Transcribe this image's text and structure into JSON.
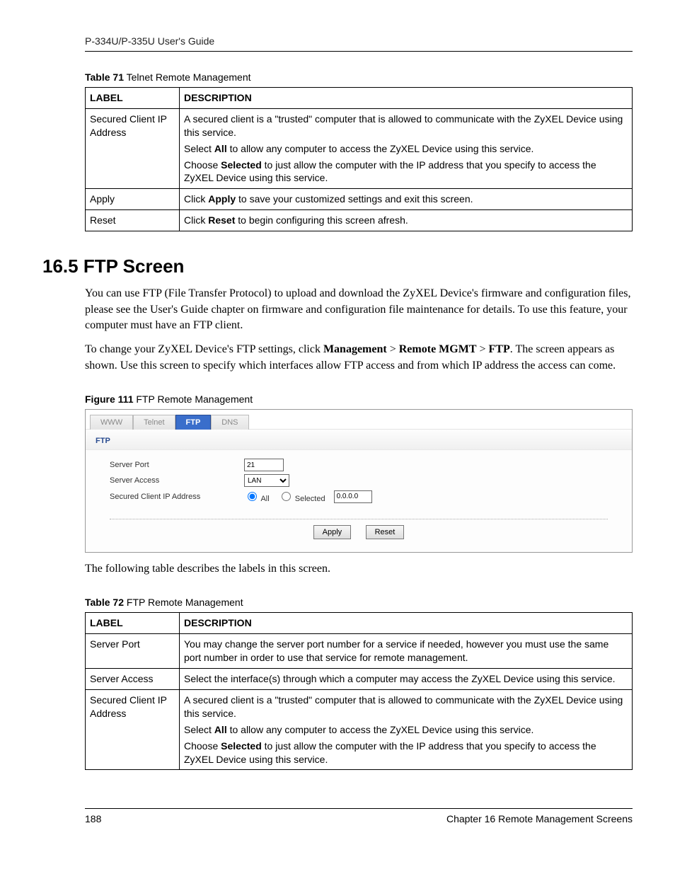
{
  "header": {
    "guide_title": "P-334U/P-335U User's Guide"
  },
  "table71": {
    "caption_bold": "Table 71",
    "caption_rest": "   Telnet Remote Management",
    "headers": {
      "label": "LABEL",
      "desc": "DESCRIPTION"
    },
    "rows": [
      {
        "label": "Secured Client IP Address",
        "desc_parts": [
          {
            "pre": "A secured client is a \"trusted\" computer that is allowed to communicate with the ZyXEL Device using this service."
          },
          {
            "pre": "Select ",
            "bold": "All",
            "post": " to allow any computer to access the ZyXEL Device using this service."
          },
          {
            "pre": "Choose ",
            "bold": "Selected",
            "post": " to just allow the computer with the IP address that you specify to access the ZyXEL Device using this service."
          }
        ]
      },
      {
        "label": "Apply",
        "desc_parts": [
          {
            "pre": "Click ",
            "bold": "Apply",
            "post": " to save your customized settings and exit this screen."
          }
        ]
      },
      {
        "label": "Reset",
        "desc_parts": [
          {
            "pre": "Click ",
            "bold": "Reset",
            "post": " to begin configuring this screen afresh."
          }
        ]
      }
    ]
  },
  "section": {
    "heading": "16.5  FTP Screen",
    "para1": "You can use FTP (File Transfer Protocol) to upload and download the ZyXEL Device's firmware and configuration files, please see the User's Guide chapter on firmware and configuration file maintenance for details. To use this feature, your computer must have an FTP client.",
    "para2_pre": "To change your ZyXEL Device's FTP settings, click ",
    "para2_b1": "Management",
    "para2_gt1": " > ",
    "para2_b2": "Remote MGMT",
    "para2_gt2": " > ",
    "para2_b3": "FTP",
    "para2_post": ". The screen appears as shown.  Use this screen to specify which interfaces allow FTP access and from which IP address the access can come."
  },
  "figure": {
    "caption_bold": "Figure 111",
    "caption_rest": "   FTP Remote Management",
    "tabs": [
      "WWW",
      "Telnet",
      "FTP",
      "DNS"
    ],
    "active_tab": "FTP",
    "panel_title": "FTP",
    "fields": {
      "server_port_label": "Server Port",
      "server_port_value": "21",
      "server_access_label": "Server Access",
      "server_access_value": "LAN",
      "secured_label": "Secured Client IP Address",
      "radio_all": "All",
      "radio_selected": "Selected",
      "ip_value": "0.0.0.0"
    },
    "buttons": {
      "apply": "Apply",
      "reset": "Reset"
    }
  },
  "after_figure": "The following table describes the labels in this screen.",
  "table72": {
    "caption_bold": "Table 72",
    "caption_rest": "   FTP Remote Management",
    "headers": {
      "label": "LABEL",
      "desc": "DESCRIPTION"
    },
    "rows": [
      {
        "label": "Server Port",
        "desc_parts": [
          {
            "pre": "You may change the server port number for a service if needed, however you must use the same port number in order to use that service for remote management."
          }
        ]
      },
      {
        "label": "Server Access",
        "desc_parts": [
          {
            "pre": "Select the interface(s) through which a computer may access the ZyXEL Device using this service."
          }
        ]
      },
      {
        "label": "Secured Client IP Address",
        "desc_parts": [
          {
            "pre": "A secured client is a \"trusted\" computer that is allowed to communicate with the ZyXEL Device using this service."
          },
          {
            "pre": "Select ",
            "bold": "All",
            "post": " to allow any computer to access the ZyXEL Device using this service."
          },
          {
            "pre": "Choose ",
            "bold": "Selected",
            "post": " to just allow the computer with the IP address that you specify to access the ZyXEL Device using this service."
          }
        ]
      }
    ]
  },
  "footer": {
    "page": "188",
    "chapter": "Chapter 16 Remote Management Screens"
  }
}
